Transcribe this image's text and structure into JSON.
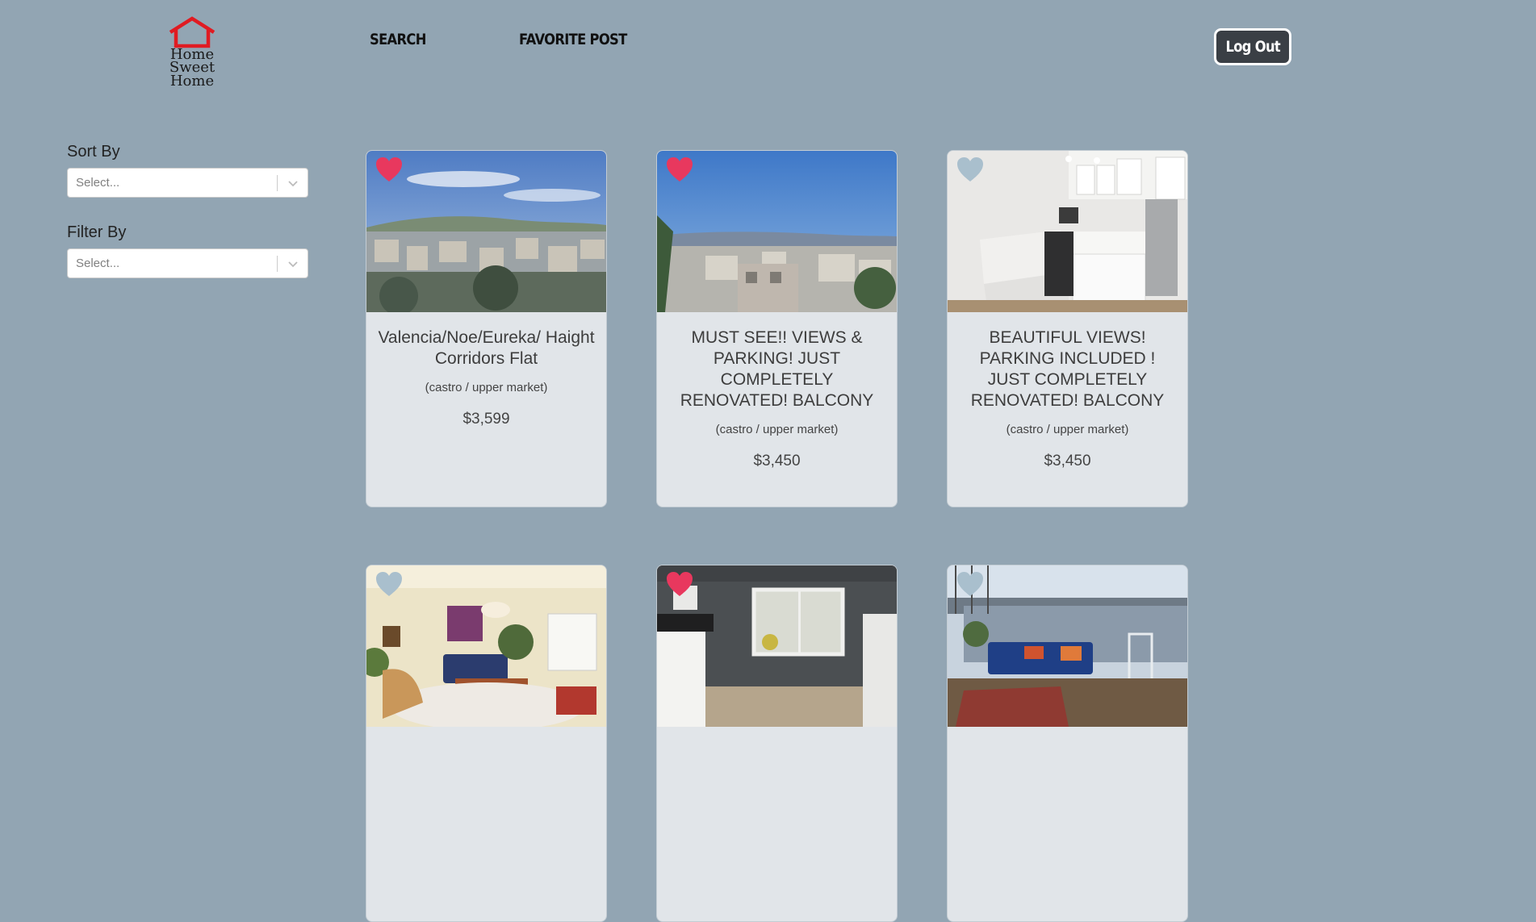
{
  "brand": {
    "line1": "Home",
    "line2": "Sweet Home"
  },
  "nav": {
    "search": "SEARCH",
    "favorite": "FAVORITE POST"
  },
  "logout": "Log Out",
  "sidebar": {
    "sort_label": "Sort By",
    "sort_placeholder": "Select...",
    "filter_label": "Filter By",
    "filter_placeholder": "Select..."
  },
  "colors": {
    "background": "#92a5b3",
    "heart_favorited": "#e8385e",
    "heart_default": "#a9bfcd",
    "logo_red": "#e01b22"
  },
  "listings": [
    {
      "title": "Valencia/Noe/Eureka/ Haight Corridors Flat",
      "location": "(castro / upper market)",
      "price": "$3,599",
      "favorited": true
    },
    {
      "title": "MUST SEE!! VIEWS & PARKING! JUST COMPLETELY RENOVATED! BALCONY",
      "location": "(castro / upper market)",
      "price": "$3,450",
      "favorited": true
    },
    {
      "title": "BEAUTIFUL VIEWS! PARKING INCLUDED ! JUST COMPLETELY RENOVATED! BALCONY",
      "location": "(castro / upper market)",
      "price": "$3,450",
      "favorited": false
    },
    {
      "title": "",
      "location": "",
      "price": "",
      "favorited": false
    },
    {
      "title": "",
      "location": "",
      "price": "",
      "favorited": true
    },
    {
      "title": "",
      "location": "",
      "price": "",
      "favorited": false
    }
  ]
}
